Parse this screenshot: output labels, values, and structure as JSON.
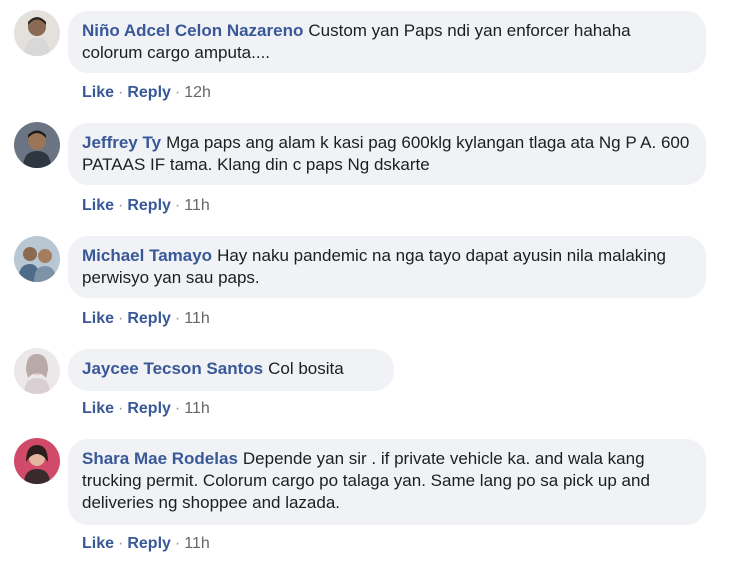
{
  "comments": [
    {
      "author": "Niño Adcel Celon Nazareno",
      "text": "Custom yan Paps ndi yan enforcer hahaha colorum cargo amputa....",
      "like": "Like",
      "reply": "Reply",
      "time": "12h"
    },
    {
      "author": "Jeffrey Ty",
      "text": "Mga paps ang alam k kasi pag 600klg kylangan tlaga ata Ng P A. 600 PATAAS IF tama. Klang din c paps Ng dskarte",
      "like": "Like",
      "reply": "Reply",
      "time": "11h"
    },
    {
      "author": "Michael Tamayo",
      "text": "Hay naku pandemic na nga tayo dapat ayusin nila malaking perwisyo yan sau paps.",
      "like": "Like",
      "reply": "Reply",
      "time": "11h"
    },
    {
      "author": "Jaycee Tecson Santos",
      "text": "Col bosita",
      "like": "Like",
      "reply": "Reply",
      "time": "11h"
    },
    {
      "author": "Shara Mae Rodelas",
      "text": "Depende yan sir . if private vehicle ka. and wala kang trucking permit. Colorum cargo po talaga yan. Same lang po sa pick up and deliveries ng shoppee and lazada.",
      "like": "Like",
      "reply": "Reply",
      "time": "11h"
    }
  ],
  "colors": {
    "name": "#385898",
    "bubble": "#f0f2f5",
    "meta": "#65676b"
  },
  "icons": [
    "avatar-photo"
  ]
}
